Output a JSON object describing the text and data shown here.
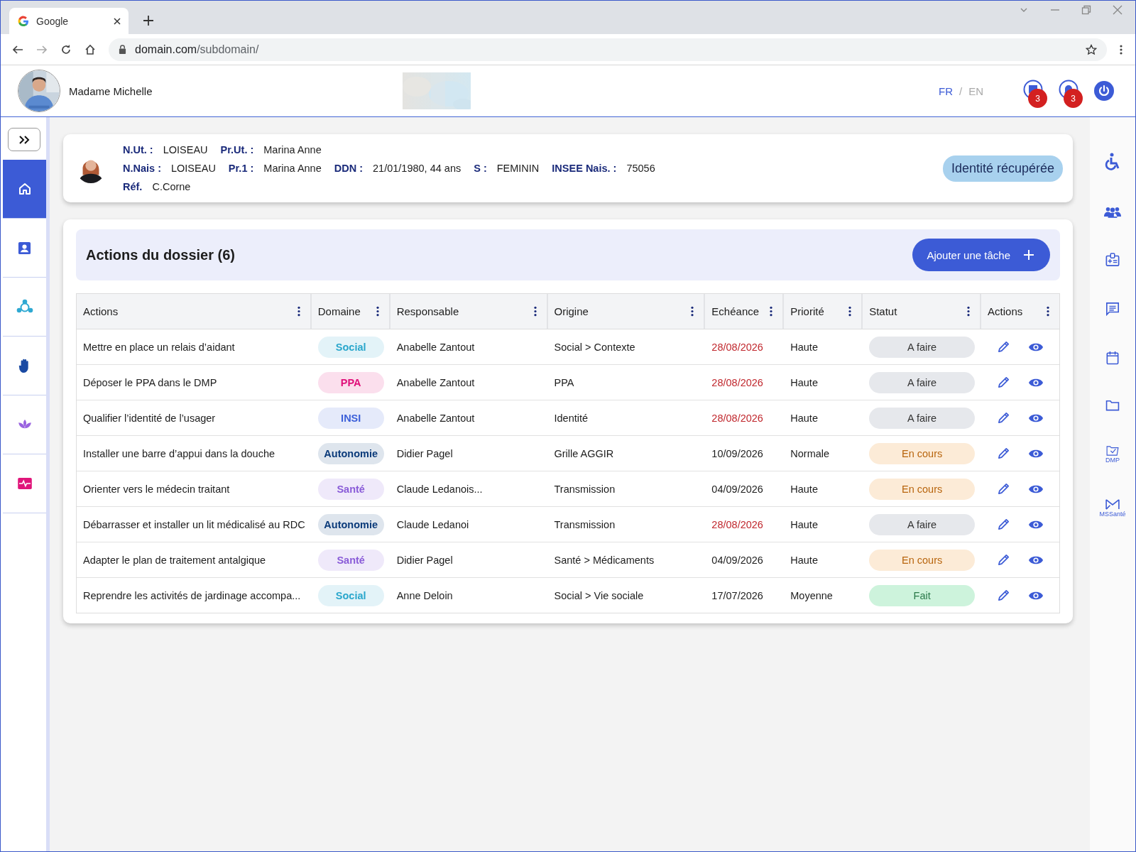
{
  "browser": {
    "tab_title": "Google",
    "url_host": "domain.com",
    "url_path": "/subdomain/"
  },
  "header": {
    "user_name": "Madame Michelle",
    "languages": [
      {
        "label": "FR",
        "selected": true
      },
      {
        "label": "EN",
        "selected": false
      }
    ],
    "separator": "/",
    "messages_badge": "3",
    "notifications_badge": "3"
  },
  "left_sidebar": {
    "items": [
      {
        "selected": true
      },
      {
        "selected": false
      },
      {
        "selected": false
      },
      {
        "selected": false
      },
      {
        "selected": false
      },
      {
        "selected": false
      }
    ]
  },
  "identity": {
    "lines": [
      [
        {
          "label": "N.Ut. :",
          "value": "LOISEAU"
        },
        {
          "label": "Pr.Ut. :",
          "value": "Marina Anne"
        }
      ],
      [
        {
          "label": "N.Nais :",
          "value": "LOISEAU"
        },
        {
          "label": "Pr.1 :",
          "value": "Marina Anne"
        },
        {
          "label": "DDN :",
          "value": "21/01/1980, 44 ans"
        },
        {
          "label": "S :",
          "value": "FEMININ"
        },
        {
          "label": "INSEE Nais. :",
          "value": "75056"
        }
      ],
      [
        {
          "label": "Réf.",
          "value": "C.Corne"
        }
      ]
    ],
    "status": "Identité récupérée"
  },
  "actions_panel": {
    "title": "Actions du dossier (6)",
    "add_button": "Ajouter une tâche"
  },
  "table": {
    "columns": [
      "Actions",
      "Domaine",
      "Responsable",
      "Origine",
      "Echéance",
      "Priorité",
      "Statut",
      "Actions"
    ],
    "rows": [
      {
        "action": "Mettre en place un relais d’aidant",
        "domain": {
          "label": "Social",
          "color": "#2aa7cc"
        },
        "responsible": "Anabelle Zantout",
        "origin": "Social > Contexte",
        "due": "28/08/2026",
        "overdue": true,
        "priority": "Haute",
        "status": {
          "label": "A faire",
          "kind": "todo"
        }
      },
      {
        "action": "Déposer le PPA dans le DMP",
        "domain": {
          "label": "PPA",
          "color": "#e0107a"
        },
        "responsible": "Anabelle Zantout",
        "origin": "PPA",
        "due": "28/08/2026",
        "overdue": true,
        "priority": "Haute",
        "status": {
          "label": "A faire",
          "kind": "todo"
        }
      },
      {
        "action": "Qualifier l’identité de l’usager",
        "domain": {
          "label": "INSI",
          "color": "#3b5fd9"
        },
        "responsible": "Anabelle Zantout",
        "origin": "Identité",
        "due": "28/08/2026",
        "overdue": true,
        "priority": "Haute",
        "status": {
          "label": "A faire",
          "kind": "todo"
        }
      },
      {
        "action": "Installer une barre d’appui dans la douche",
        "domain": {
          "label": "Autonomie",
          "color": "#0b3b7a"
        },
        "responsible": "Didier Pagel",
        "origin": "Grille AGGIR",
        "due": "10/09/2026",
        "overdue": false,
        "priority": "Normale",
        "status": {
          "label": "En cours",
          "kind": "in_progress"
        }
      },
      {
        "action": "Orienter vers le médecin traitant",
        "domain": {
          "label": "Santé",
          "color": "#8a5cd8"
        },
        "responsible": "Claude Ledanois...",
        "origin": "Transmission",
        "due": "04/09/2026",
        "overdue": false,
        "priority": "Haute",
        "status": {
          "label": "En cours",
          "kind": "in_progress"
        }
      },
      {
        "action": "Débarrasser et installer un lit médicalisé au RDC",
        "domain": {
          "label": "Autonomie",
          "color": "#0b3b7a"
        },
        "responsible": "Claude Ledanoi",
        "origin": "Transmission",
        "due": "28/08/2026",
        "overdue": true,
        "priority": "Haute",
        "status": {
          "label": "A faire",
          "kind": "todo"
        }
      },
      {
        "action": "Adapter le plan de traitement antalgique",
        "domain": {
          "label": "Santé",
          "color": "#8a5cd8"
        },
        "responsible": "Didier Pagel",
        "origin": "Santé > Médicaments",
        "due": "04/09/2026",
        "overdue": false,
        "priority": "Haute",
        "status": {
          "label": "En cours",
          "kind": "in_progress"
        }
      },
      {
        "action": "Reprendre les activités de jardinage accompa...",
        "domain": {
          "label": "Social",
          "color": "#2aa7cc"
        },
        "responsible": "Anne Deloin",
        "origin": "Social > Vie sociale",
        "due": "17/07/2026",
        "overdue": false,
        "priority": "Moyenne",
        "status": {
          "label": "Fait",
          "kind": "done"
        }
      }
    ]
  },
  "right_sidebar": {
    "dmp_label": "DMP",
    "mssante_label": "MSSanté"
  }
}
